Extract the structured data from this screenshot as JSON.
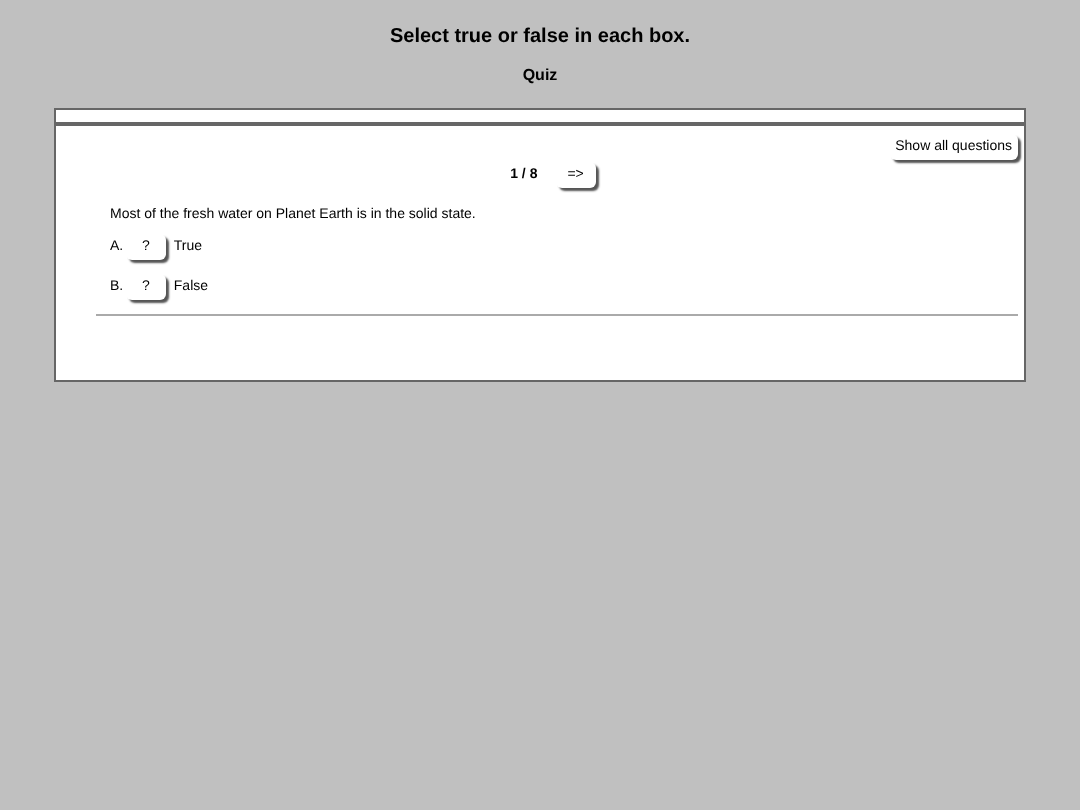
{
  "header": {
    "title": "Select true or false in each box.",
    "subtitle": "Quiz"
  },
  "toolbar": {
    "show_all_button": "Show all questions"
  },
  "navigation": {
    "counter": "1 / 8",
    "next_button": "=>"
  },
  "question": {
    "text": "Most of the fresh water on Planet Earth is in the solid state.",
    "options": [
      {
        "letter": "A.",
        "answer_box": "?",
        "label": "True"
      },
      {
        "letter": "B.",
        "answer_box": "?",
        "label": "False"
      }
    ]
  }
}
